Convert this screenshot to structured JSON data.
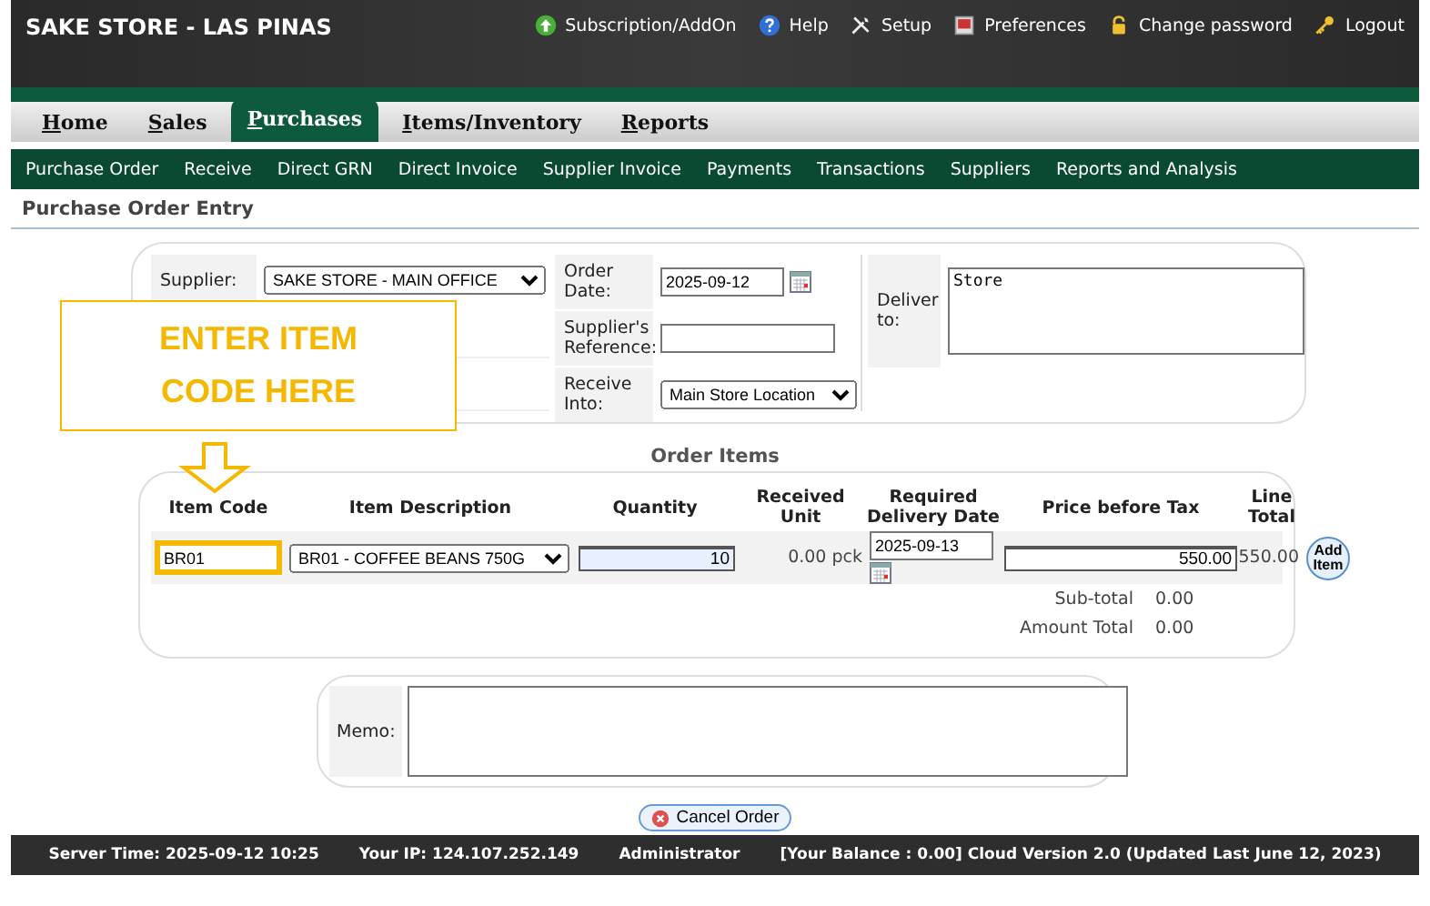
{
  "header": {
    "title": "SAKE STORE - LAS PINAS",
    "links": [
      {
        "label": "Subscription/AddOn",
        "kind": "upgrade"
      },
      {
        "label": "Help",
        "kind": "help"
      },
      {
        "label": "Setup",
        "kind": "tools"
      },
      {
        "label": "Preferences",
        "kind": "prefs"
      },
      {
        "label": "Change password",
        "kind": "lock"
      },
      {
        "label": "Logout",
        "kind": "key"
      }
    ]
  },
  "tabs": [
    {
      "label": "Home",
      "selected": false
    },
    {
      "label": "Sales",
      "selected": false
    },
    {
      "label": "Purchases",
      "selected": true
    },
    {
      "label": "Items/Inventory",
      "selected": false
    },
    {
      "label": "Reports",
      "selected": false
    }
  ],
  "subnav": [
    "Purchase Order",
    "Receive",
    "Direct GRN",
    "Direct Invoice",
    "Supplier Invoice",
    "Payments",
    "Transactions",
    "Suppliers",
    "Reports and Analysis"
  ],
  "page_title": "Purchase Order Entry",
  "order_header": {
    "supplier": {
      "label": "Supplier:",
      "value": "SAKE STORE - MAIN OFFICE"
    },
    "order_date": {
      "label": "Order Date:",
      "value": "2025-09-12"
    },
    "reference": {
      "label": "Supplier's Reference:"
    },
    "receive_into": {
      "label": "Receive Into:",
      "value": "Main Store Location"
    },
    "deliver_to": {
      "label": "Deliver to:",
      "value": "Store"
    }
  },
  "callout": {
    "text": "ENTER ITEM CODE HERE"
  },
  "order_items": {
    "title": "Order Items",
    "columns": [
      "Item Code",
      "Item Description",
      "Quantity",
      "Received Unit",
      "Required Delivery Date",
      "Price before Tax",
      "Line Total"
    ],
    "rows": [
      {
        "code": "BR01",
        "description": "BR01 - COFFEE BEANS 750G",
        "quantity": "10",
        "received_unit": "0.00 pck",
        "delivery_date": "2025-09-13",
        "price": "550.00",
        "line_total": "550.00",
        "button": "Add Item"
      }
    ],
    "totals": [
      {
        "label": "Sub-total",
        "value": "0.00"
      },
      {
        "label": "Amount Total",
        "value": "0.00"
      }
    ]
  },
  "memo": {
    "label": "Memo:"
  },
  "cancel_button": "Cancel Order",
  "footer": [
    "Server Time: 2025-09-12 10:25",
    "Your IP: 124.107.252.149",
    "Administrator",
    "[Your Balance : 0.00] Cloud Version 2.0 (Updated Last June 12, 2023)"
  ]
}
